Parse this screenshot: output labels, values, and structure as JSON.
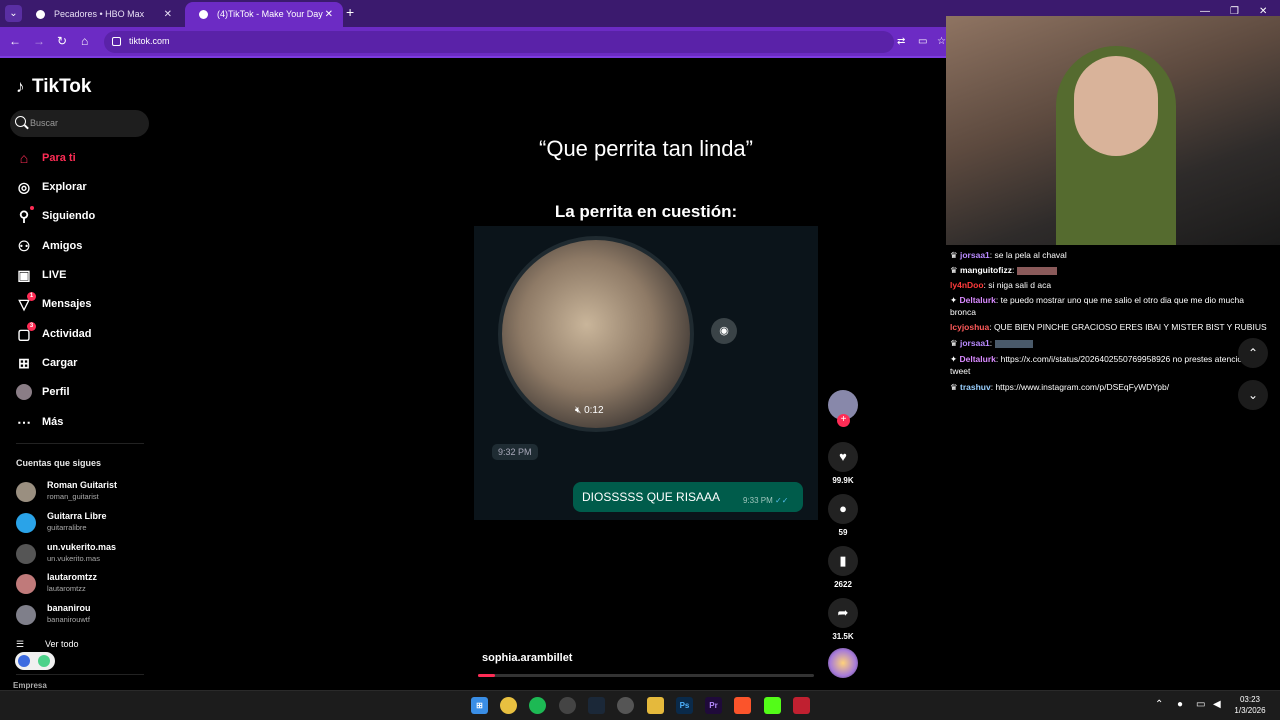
{
  "browser": {
    "tabs": [
      {
        "label": "Pecadores • HBO Max"
      },
      {
        "label": "(4)TikTok - Make Your Day"
      }
    ],
    "url": "tiktok.com",
    "accent": "#6c2bc4"
  },
  "tiktok": {
    "logo": "TikTok",
    "search_placeholder": "Buscar",
    "nav": [
      {
        "label": "Para ti",
        "icon": "home-icon"
      },
      {
        "label": "Explorar",
        "icon": "compass-icon"
      },
      {
        "label": "Siguiendo",
        "icon": "following-icon"
      },
      {
        "label": "Amigos",
        "icon": "friends-icon"
      },
      {
        "label": "LIVE",
        "icon": "live-icon"
      },
      {
        "label": "Mensajes",
        "icon": "messages-icon",
        "badge": "1"
      },
      {
        "label": "Actividad",
        "icon": "activity-icon",
        "badge": "3"
      },
      {
        "label": "Cargar",
        "icon": "upload-icon"
      },
      {
        "label": "Perfil",
        "icon": "avatar"
      },
      {
        "label": "Más",
        "icon": "more-icon"
      }
    ],
    "following_title": "Cuentas que sigues",
    "following": [
      {
        "name": "Roman Guitarist",
        "user": "roman_guitarist"
      },
      {
        "name": "Guitarra Libre",
        "user": "guitarralibre"
      },
      {
        "name": "un.vukerito.mas",
        "user": "un.vukerito.mas"
      },
      {
        "name": "lautaromtzz",
        "user": "lautaromtzz"
      },
      {
        "name": "bananirou",
        "user": "bananirouwtf"
      }
    ],
    "see_all": "Ver todo",
    "company": "Empresa",
    "video": {
      "title": "“Que perrita tan linda”",
      "subtitle": "La perrita en cuestión:",
      "voice_duration": "0:12",
      "time_in": "9:32 PM",
      "reply_text": "DIOSSSSS QUE RISAAA",
      "reply_time": "9:33 PM",
      "author": "sophia.arambillet",
      "progress": 0.05
    },
    "actions": {
      "likes": "99.9K",
      "comments": "59",
      "saves": "2622",
      "shares": "31.5K"
    },
    "brand_color": "#fe2c55"
  },
  "stream_chat": [
    {
      "user": "jorsaa1",
      "color": "#b98aff",
      "text": ": se la pela al chaval"
    },
    {
      "user": "manguitofizz",
      "color": "#ffffff",
      "text": ":"
    },
    {
      "user": "ly4nDoo",
      "color": "#ff3b3b",
      "text": ": si niga sali d aca"
    },
    {
      "user": "Deltalurk",
      "color": "#d98aff",
      "text": ": te puedo mostrar uno que me salio el otro dia que me dio mucha bronca"
    },
    {
      "user": "lcyjoshua",
      "color": "#ff5a5a",
      "text": ": QUE BIEN PINCHE GRACIOSO ERES IBAI Y MISTER BIST Y RUBIUS"
    },
    {
      "user": "jorsaa1",
      "color": "#b98aff",
      "text": ":"
    },
    {
      "user": "Deltalurk",
      "color": "#d98aff",
      "text": ": https://x.com/i/status/2026402550769958926 no prestes atencion al tweet"
    },
    {
      "user": "trashuv",
      "color": "#9ad0ff",
      "text": ": https://www.instagram.com/p/DSEqFyWDYpb/"
    }
  ],
  "taskbar": {
    "time": "03:23",
    "date": "1/3/2026"
  }
}
